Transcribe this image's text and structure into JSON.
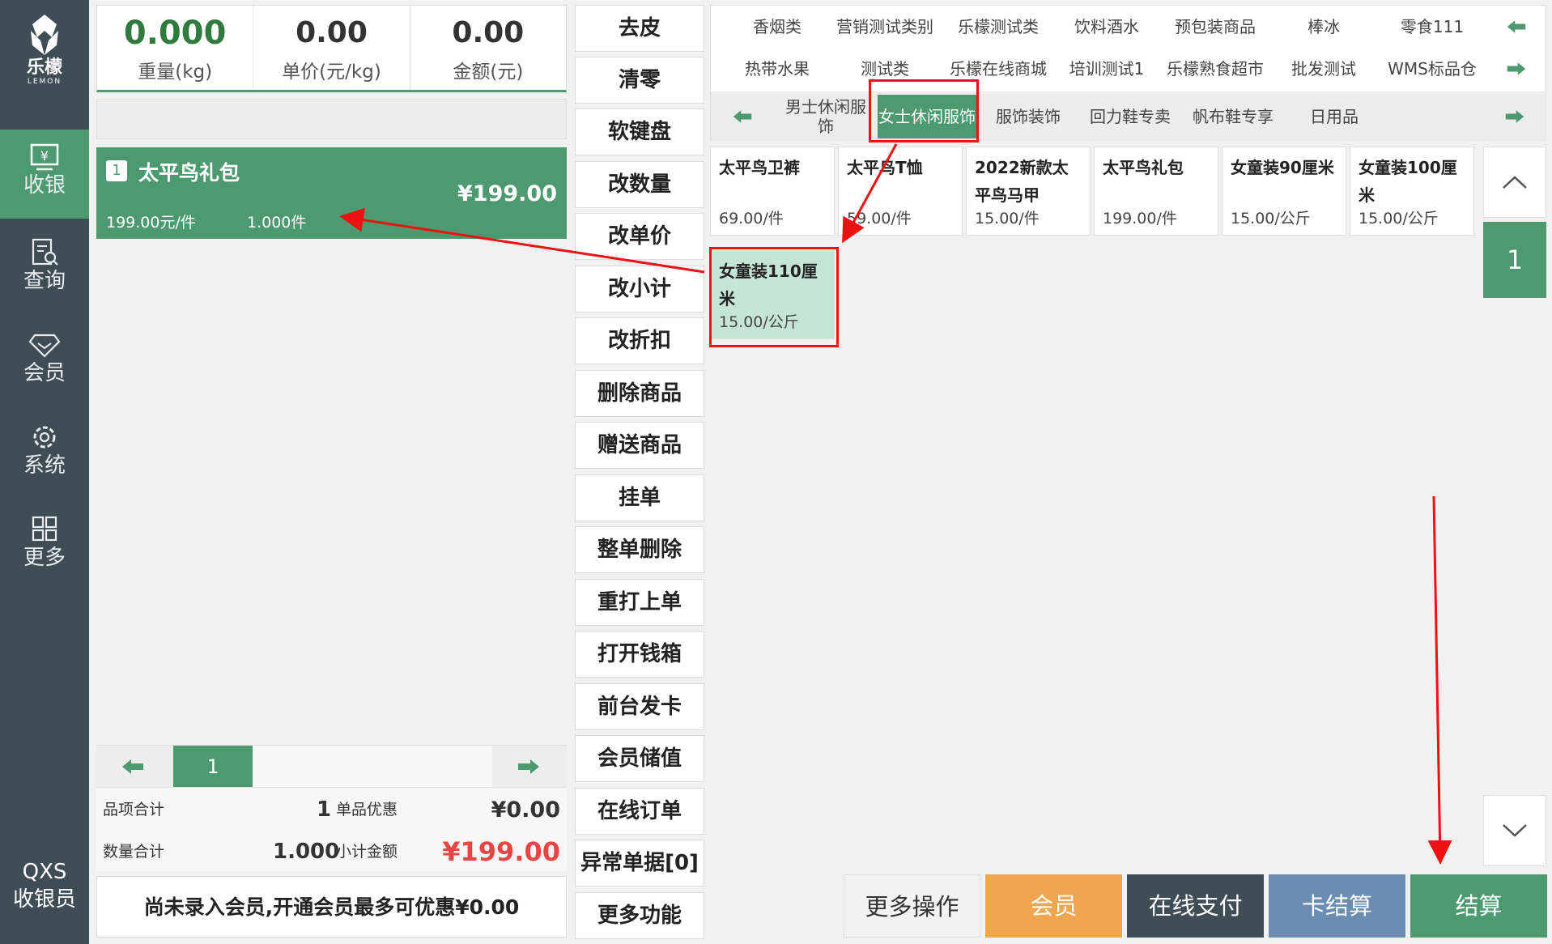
{
  "brand": {
    "name": "乐檬",
    "sub": "LEMON"
  },
  "colors": {
    "accent": "#4e9a70",
    "sidebar": "#3f4d57",
    "member": "#f0a64e",
    "online_pay": "#3f4d57",
    "card_pay": "#6a8db1",
    "red": "#e94545"
  },
  "nav": [
    {
      "label": "收银",
      "icon": "cash-register-icon",
      "active": true
    },
    {
      "label": "查询",
      "icon": "query-icon"
    },
    {
      "label": "会员",
      "icon": "member-diamond-icon"
    },
    {
      "label": "系统",
      "icon": "settings-gear-icon"
    },
    {
      "label": "更多",
      "icon": "more-grid-icon"
    }
  ],
  "user": {
    "name": "QXS",
    "role": "收银员"
  },
  "scale": {
    "weight": "0.000",
    "weight_label": "重量(kg)",
    "unit_price": "0.00",
    "unit_price_label": "单价(元/kg)",
    "amount": "0.00",
    "amount_label": "金额(元)"
  },
  "cart": {
    "items": [
      {
        "index": "1",
        "name": "太平鸟礼包",
        "price": "¥199.00",
        "unit_price": "199.00元/件",
        "qty": "1.000件"
      }
    ],
    "page": "1"
  },
  "totals": {
    "items_label": "品项合计",
    "items_count": "1",
    "discount_label": "单品优惠",
    "discount": "¥0.00",
    "qty_label": "数量合计",
    "qty": "1.000",
    "subtotal_label": "小计金额",
    "subtotal": "¥199.00"
  },
  "member_hint": "尚未录入会员,开通会员最多可优惠¥0.00",
  "functions": [
    "去皮",
    "清零",
    "软键盘",
    "改数量",
    "改单价",
    "改小计",
    "改折扣",
    "删除商品",
    "赠送商品",
    "挂单",
    "整单删除",
    "重打上单",
    "打开钱箱",
    "前台发卡",
    "会员储值",
    "在线订单",
    "异常单据[0]",
    "更多功能"
  ],
  "categories_row1": [
    "香烟类",
    "营销测试类别",
    "乐檬测试类",
    "饮料酒水",
    "预包装商品",
    "棒冰",
    "零食111"
  ],
  "categories_row2": [
    "热带水果",
    "测试类",
    "乐檬在线商城",
    "培训测试1",
    "乐檬熟食超市",
    "批发测试",
    "WMS标品仓"
  ],
  "subcategories": [
    "男士休闲服饰",
    "女士休闲服饰",
    "服饰装饰",
    "回力鞋专卖",
    "帆布鞋专享",
    "日用品"
  ],
  "products": [
    {
      "name": "太平鸟卫裤",
      "price": "69.00/件"
    },
    {
      "name": "太平鸟T恤",
      "price": "59.00/件"
    },
    {
      "name": "2022新款太平鸟马甲",
      "price": "15.00/件"
    },
    {
      "name": "太平鸟礼包",
      "price": "199.00/件"
    },
    {
      "name": "女童装90厘米",
      "price": "15.00/公斤"
    },
    {
      "name": "女童装100厘米",
      "price": "15.00/公斤"
    },
    {
      "name": "女童装110厘米",
      "price": "15.00/公斤",
      "selected": true
    }
  ],
  "product_page": "1",
  "bottom": {
    "more_ops": "更多操作",
    "member": "会员",
    "online_pay": "在线支付",
    "card_pay": "卡结算",
    "checkout": "结算"
  }
}
